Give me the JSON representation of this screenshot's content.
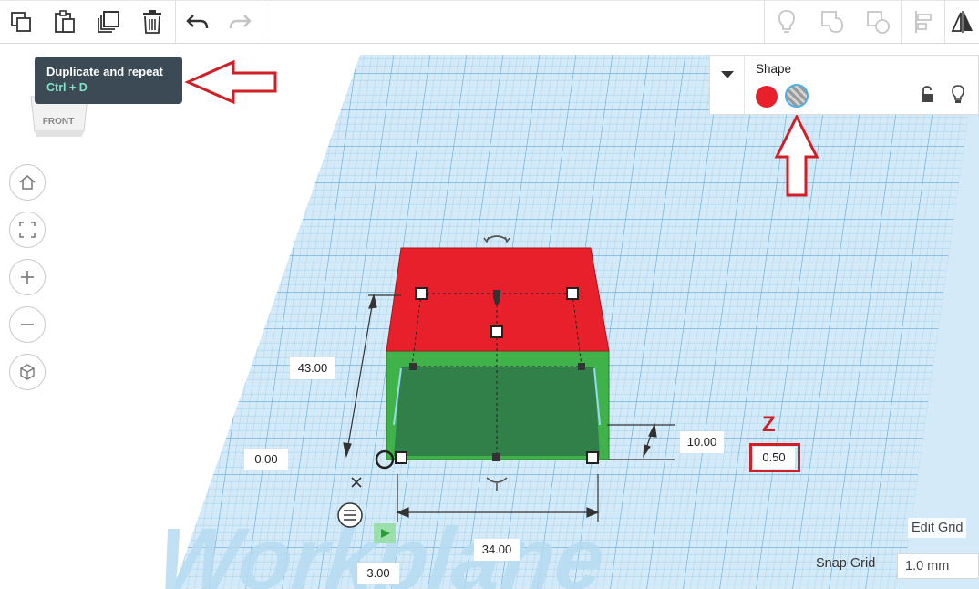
{
  "toolbar": {
    "buttons": [
      "copy-icon",
      "paste-icon",
      "duplicate-icon",
      "delete-icon",
      "undo-icon",
      "redo-icon",
      "light-icon",
      "group-icon",
      "ungroup-icon",
      "align-icon",
      "mirror-icon"
    ]
  },
  "tooltip": {
    "title": "Duplicate and repeat",
    "shortcut": "Ctrl + D"
  },
  "viewcube": {
    "face_label": "FRONT"
  },
  "shape_panel": {
    "title": "Shape",
    "solid_color": "#e8202b",
    "hole_option": "hole"
  },
  "dimensions": {
    "height": "43.00",
    "base_offset": "0.00",
    "depth": "10.00",
    "elevation": "0.50",
    "width": "34.00",
    "offset_y": "3.00"
  },
  "annotation": {
    "z_label": "Z"
  },
  "workplane": {
    "watermark": "Workplane",
    "edit_grid": "Edit Grid",
    "snap_grid_label": "Snap Grid",
    "snap_grid_value": "1.0 mm"
  },
  "colors": {
    "grid_bg": "#d4eaf8",
    "grid_line": "#8cc3e6",
    "box_top": "#e8202b",
    "box_side": "#3fb24a",
    "arrow": "#d01f26",
    "tooltip_bg": "#3b4a55"
  }
}
